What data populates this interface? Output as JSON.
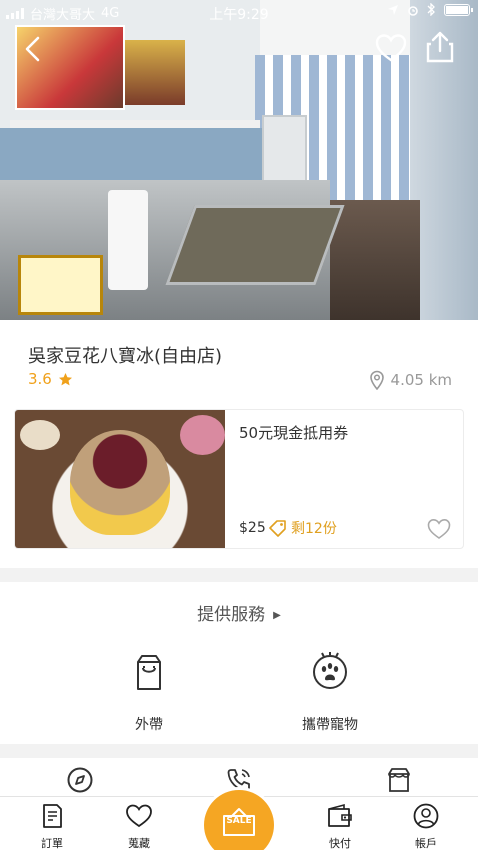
{
  "status_bar": {
    "carrier": "台灣大哥大",
    "network": "4G",
    "time": "上午9:29",
    "battery_level": 0.9
  },
  "header": {
    "back_icon": "chevron-left-icon",
    "favorite_icon": "heart-icon",
    "share_icon": "share-icon"
  },
  "shop": {
    "name": "吳家豆花八寶冰(自由店)",
    "rating": "3.6",
    "distance": "4.05 km"
  },
  "deal": {
    "title": "50元現金抵用券",
    "price": "$25",
    "remaining": "剩12份"
  },
  "services": {
    "title": "提供服務",
    "items": [
      {
        "label": "外帶",
        "icon": "takeout-bag-icon"
      },
      {
        "label": "攜帶寵物",
        "icon": "pet-paw-icon"
      }
    ]
  },
  "more_actions": {
    "icons": [
      "compass-icon",
      "phone-icon",
      "store-icon"
    ]
  },
  "tabbar": {
    "items": [
      {
        "label": "訂單",
        "icon": "order-icon"
      },
      {
        "label": "蒐藏",
        "icon": "heart-icon"
      },
      {
        "label": "SALE",
        "icon": "sale-tag-icon"
      },
      {
        "label": "快付",
        "icon": "wallet-icon"
      },
      {
        "label": "帳戶",
        "icon": "account-icon"
      }
    ]
  },
  "colors": {
    "accent": "#f5a623",
    "rating": "#f0a11b",
    "muted": "#999999"
  }
}
